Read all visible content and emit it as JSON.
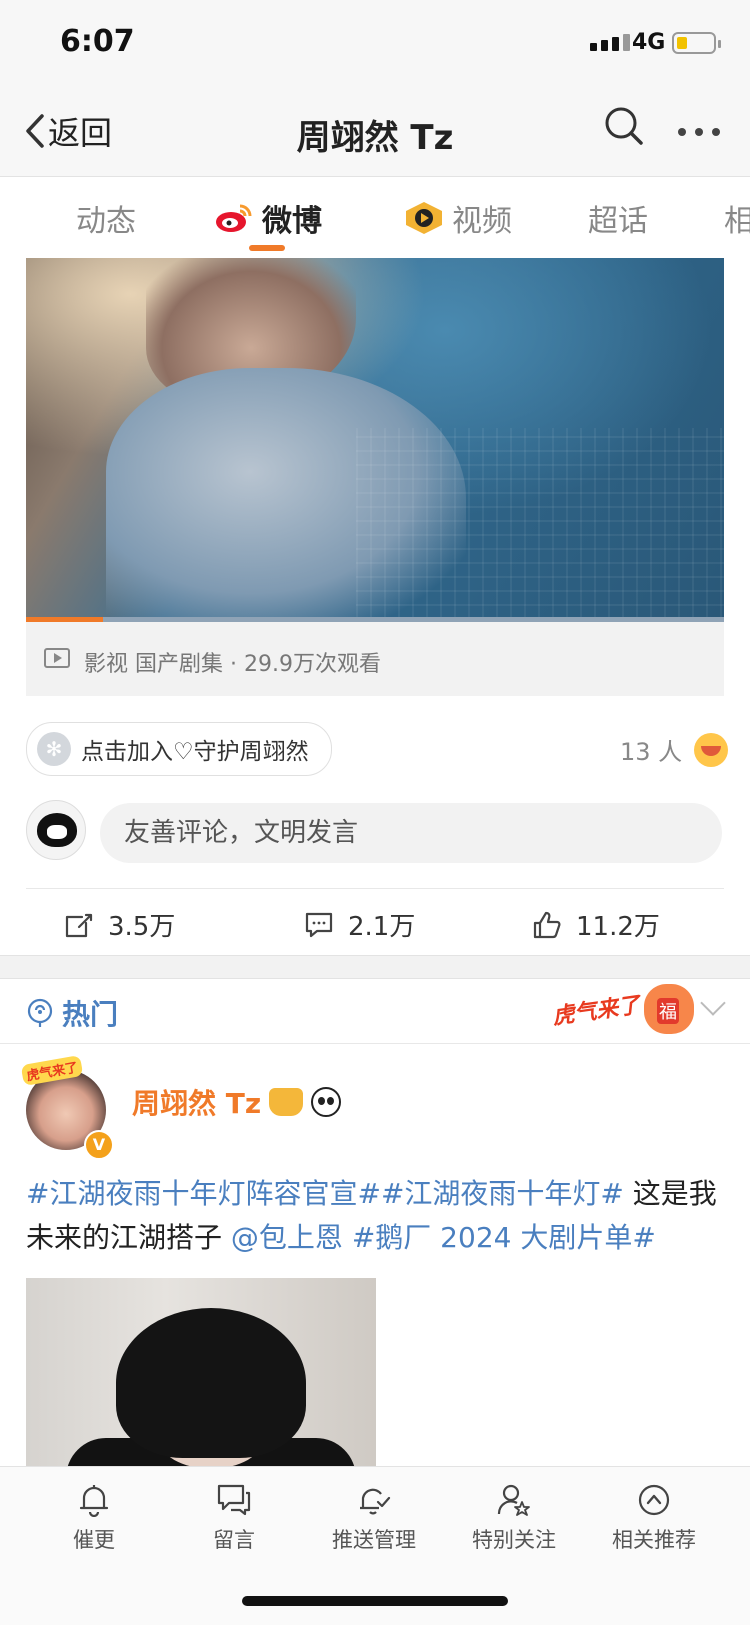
{
  "status_bar": {
    "time": "6:07",
    "network": "4G"
  },
  "nav": {
    "back_label": "返回",
    "title": "周翊然 Tz"
  },
  "tabs": [
    {
      "label": "动态"
    },
    {
      "label": "微博"
    },
    {
      "label": "视频"
    },
    {
      "label": "超话"
    },
    {
      "label": "相"
    }
  ],
  "video": {
    "meta": "影视 国产剧集 · 29.9万次观看",
    "progress": 0.11
  },
  "guard": {
    "label": "点击加入♡守护周翊然",
    "count": "13 人"
  },
  "comment": {
    "placeholder": "友善评论，文明发言"
  },
  "actions": {
    "repost": "3.5万",
    "comments": "2.1万",
    "likes": "11.2万"
  },
  "hot": {
    "label": "热门",
    "badge": "虎气来了"
  },
  "post": {
    "author": "周翊然 Tz",
    "avatar_badge": "虎气来了",
    "tag1": "#江湖夜雨十年灯阵容官宣#",
    "tag2": "#江湖夜雨十年灯#",
    "text1": " 这是我未来的江湖搭子 ",
    "mention": "@包上恩",
    "tag3": " #鹅厂 2024 大剧片单#"
  },
  "toolbar": [
    {
      "label": "催更",
      "icon": "bell-icon"
    },
    {
      "label": "留言",
      "icon": "message-icon"
    },
    {
      "label": "推送管理",
      "icon": "bell-check-icon"
    },
    {
      "label": "特别关注",
      "icon": "user-star-icon"
    },
    {
      "label": "相关推荐",
      "icon": "arrow-up-circle-icon"
    }
  ],
  "colors": {
    "accent": "#f07a29",
    "link": "#4a7fbf"
  }
}
